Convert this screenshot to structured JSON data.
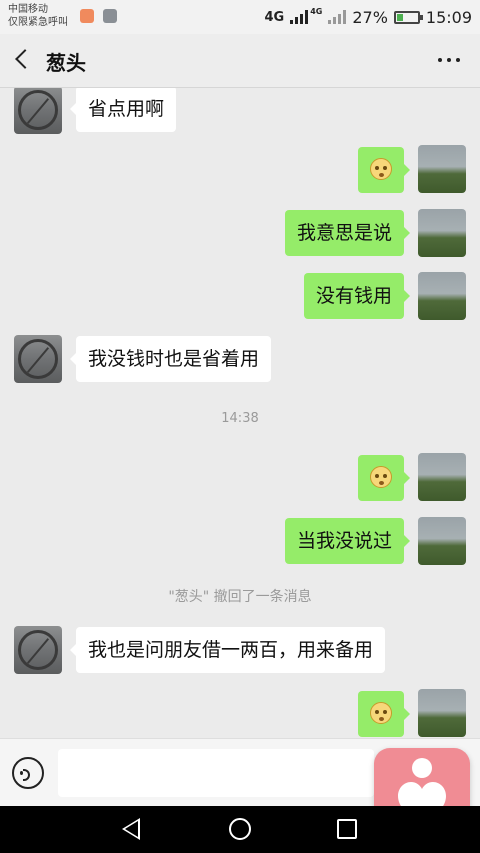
{
  "status_bar": {
    "carrier_line1": "中国移动",
    "carrier_line2": "仅限紧急呼叫",
    "network": "4G",
    "network_small": "4G",
    "battery_percent": "27%",
    "battery_level": 0.27,
    "time": "15:09"
  },
  "header": {
    "title": "葱头"
  },
  "messages": [
    {
      "side": "in",
      "type": "text",
      "text": "省点用啊"
    },
    {
      "side": "out",
      "type": "emoji",
      "text": ""
    },
    {
      "side": "out",
      "type": "text",
      "text": "我意思是说"
    },
    {
      "side": "out",
      "type": "text",
      "text": "没有钱用"
    },
    {
      "side": "in",
      "type": "text",
      "text": "我没钱时也是省着用"
    },
    {
      "type": "time",
      "text": "14:38"
    },
    {
      "side": "out",
      "type": "emoji",
      "text": ""
    },
    {
      "side": "out",
      "type": "text",
      "text": "当我没说过"
    },
    {
      "type": "system",
      "text": "\"葱头\" 撤回了一条消息"
    },
    {
      "side": "in",
      "type": "text",
      "text": "我也是问朋友借一两百，用来备用"
    },
    {
      "side": "out",
      "type": "emoji",
      "text": ""
    }
  ],
  "input": {
    "value": "",
    "placeholder": ""
  },
  "colors": {
    "outgoing_bubble": "#95ec69",
    "incoming_bubble": "#ffffff",
    "background": "#ebebeb"
  }
}
